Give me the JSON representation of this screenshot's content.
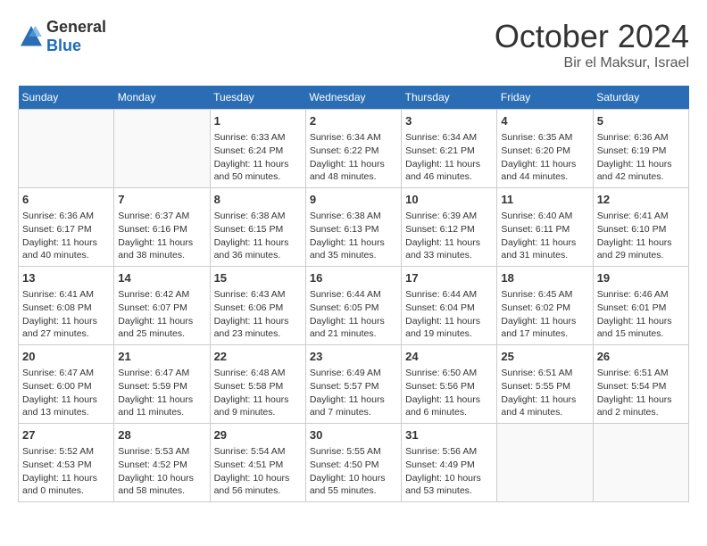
{
  "header": {
    "logo_general": "General",
    "logo_blue": "Blue",
    "month": "October 2024",
    "location": "Bir el Maksur, Israel"
  },
  "weekdays": [
    "Sunday",
    "Monday",
    "Tuesday",
    "Wednesday",
    "Thursday",
    "Friday",
    "Saturday"
  ],
  "weeks": [
    [
      {
        "day": "",
        "info": ""
      },
      {
        "day": "",
        "info": ""
      },
      {
        "day": "1",
        "info": "Sunrise: 6:33 AM\nSunset: 6:24 PM\nDaylight: 11 hours and 50 minutes."
      },
      {
        "day": "2",
        "info": "Sunrise: 6:34 AM\nSunset: 6:22 PM\nDaylight: 11 hours and 48 minutes."
      },
      {
        "day": "3",
        "info": "Sunrise: 6:34 AM\nSunset: 6:21 PM\nDaylight: 11 hours and 46 minutes."
      },
      {
        "day": "4",
        "info": "Sunrise: 6:35 AM\nSunset: 6:20 PM\nDaylight: 11 hours and 44 minutes."
      },
      {
        "day": "5",
        "info": "Sunrise: 6:36 AM\nSunset: 6:19 PM\nDaylight: 11 hours and 42 minutes."
      }
    ],
    [
      {
        "day": "6",
        "info": "Sunrise: 6:36 AM\nSunset: 6:17 PM\nDaylight: 11 hours and 40 minutes."
      },
      {
        "day": "7",
        "info": "Sunrise: 6:37 AM\nSunset: 6:16 PM\nDaylight: 11 hours and 38 minutes."
      },
      {
        "day": "8",
        "info": "Sunrise: 6:38 AM\nSunset: 6:15 PM\nDaylight: 11 hours and 36 minutes."
      },
      {
        "day": "9",
        "info": "Sunrise: 6:38 AM\nSunset: 6:13 PM\nDaylight: 11 hours and 35 minutes."
      },
      {
        "day": "10",
        "info": "Sunrise: 6:39 AM\nSunset: 6:12 PM\nDaylight: 11 hours and 33 minutes."
      },
      {
        "day": "11",
        "info": "Sunrise: 6:40 AM\nSunset: 6:11 PM\nDaylight: 11 hours and 31 minutes."
      },
      {
        "day": "12",
        "info": "Sunrise: 6:41 AM\nSunset: 6:10 PM\nDaylight: 11 hours and 29 minutes."
      }
    ],
    [
      {
        "day": "13",
        "info": "Sunrise: 6:41 AM\nSunset: 6:08 PM\nDaylight: 11 hours and 27 minutes."
      },
      {
        "day": "14",
        "info": "Sunrise: 6:42 AM\nSunset: 6:07 PM\nDaylight: 11 hours and 25 minutes."
      },
      {
        "day": "15",
        "info": "Sunrise: 6:43 AM\nSunset: 6:06 PM\nDaylight: 11 hours and 23 minutes."
      },
      {
        "day": "16",
        "info": "Sunrise: 6:44 AM\nSunset: 6:05 PM\nDaylight: 11 hours and 21 minutes."
      },
      {
        "day": "17",
        "info": "Sunrise: 6:44 AM\nSunset: 6:04 PM\nDaylight: 11 hours and 19 minutes."
      },
      {
        "day": "18",
        "info": "Sunrise: 6:45 AM\nSunset: 6:02 PM\nDaylight: 11 hours and 17 minutes."
      },
      {
        "day": "19",
        "info": "Sunrise: 6:46 AM\nSunset: 6:01 PM\nDaylight: 11 hours and 15 minutes."
      }
    ],
    [
      {
        "day": "20",
        "info": "Sunrise: 6:47 AM\nSunset: 6:00 PM\nDaylight: 11 hours and 13 minutes."
      },
      {
        "day": "21",
        "info": "Sunrise: 6:47 AM\nSunset: 5:59 PM\nDaylight: 11 hours and 11 minutes."
      },
      {
        "day": "22",
        "info": "Sunrise: 6:48 AM\nSunset: 5:58 PM\nDaylight: 11 hours and 9 minutes."
      },
      {
        "day": "23",
        "info": "Sunrise: 6:49 AM\nSunset: 5:57 PM\nDaylight: 11 hours and 7 minutes."
      },
      {
        "day": "24",
        "info": "Sunrise: 6:50 AM\nSunset: 5:56 PM\nDaylight: 11 hours and 6 minutes."
      },
      {
        "day": "25",
        "info": "Sunrise: 6:51 AM\nSunset: 5:55 PM\nDaylight: 11 hours and 4 minutes."
      },
      {
        "day": "26",
        "info": "Sunrise: 6:51 AM\nSunset: 5:54 PM\nDaylight: 11 hours and 2 minutes."
      }
    ],
    [
      {
        "day": "27",
        "info": "Sunrise: 5:52 AM\nSunset: 4:53 PM\nDaylight: 11 hours and 0 minutes."
      },
      {
        "day": "28",
        "info": "Sunrise: 5:53 AM\nSunset: 4:52 PM\nDaylight: 10 hours and 58 minutes."
      },
      {
        "day": "29",
        "info": "Sunrise: 5:54 AM\nSunset: 4:51 PM\nDaylight: 10 hours and 56 minutes."
      },
      {
        "day": "30",
        "info": "Sunrise: 5:55 AM\nSunset: 4:50 PM\nDaylight: 10 hours and 55 minutes."
      },
      {
        "day": "31",
        "info": "Sunrise: 5:56 AM\nSunset: 4:49 PM\nDaylight: 10 hours and 53 minutes."
      },
      {
        "day": "",
        "info": ""
      },
      {
        "day": "",
        "info": ""
      }
    ]
  ]
}
